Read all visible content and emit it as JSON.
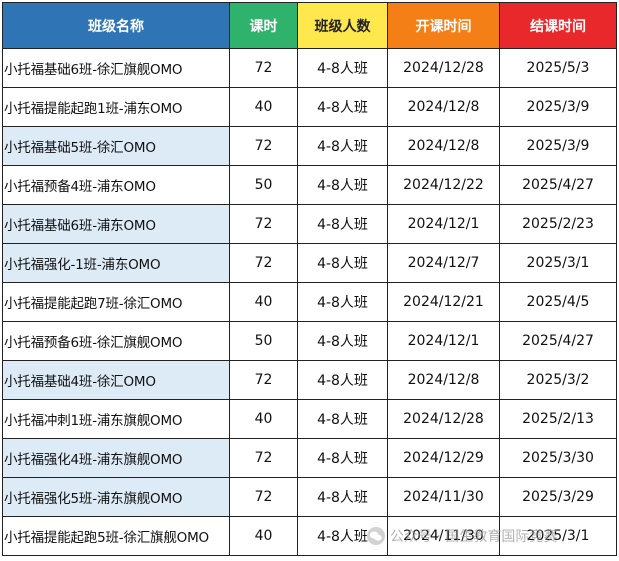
{
  "header": {
    "name": "班级名称",
    "hours": "课时",
    "size": "班级人数",
    "start": "开课时间",
    "end": "结课时间"
  },
  "colors": {
    "header_name_bg": "#2f75b5",
    "header_hours_bg": "#2fb26b",
    "header_size_bg": "#ffe84d",
    "header_start_bg": "#f57f17",
    "header_end_bg": "#e8282b",
    "row_highlight_bg": "#ddebf7"
  },
  "rows": [
    {
      "name": "小托福基础6班-徐汇旗舰OMO",
      "hours": "72",
      "size": "4-8人班",
      "start": "2024/12/28",
      "end": "2025/5/3"
    },
    {
      "name": "小托福提能起跑1班-浦东OMO",
      "hours": "40",
      "size": "4-8人班",
      "start": "2024/12/8",
      "end": "2025/3/9"
    },
    {
      "name": "小托福基础5班-徐汇OMO",
      "hours": "72",
      "size": "4-8人班",
      "start": "2024/12/8",
      "end": "2025/3/9"
    },
    {
      "name": "小托福预备4班-浦东OMO",
      "hours": "50",
      "size": "4-8人班",
      "start": "2024/12/22",
      "end": "2025/4/27"
    },
    {
      "name": "小托福基础6班-浦东OMO",
      "hours": "72",
      "size": "4-8人班",
      "start": "2024/12/1",
      "end": "2025/2/23"
    },
    {
      "name": "小托福强化-1班-浦东OMO",
      "hours": "72",
      "size": "4-8人班",
      "start": "2024/12/7",
      "end": "2025/3/1"
    },
    {
      "name": "小托福提能起跑7班-徐汇OMO",
      "hours": "40",
      "size": "4-8人班",
      "start": "2024/12/21",
      "end": "2025/4/5"
    },
    {
      "name": "小托福预备6班-徐汇旗舰OMO",
      "hours": "50",
      "size": "4-8人班",
      "start": "2024/12/1",
      "end": "2025/4/27"
    },
    {
      "name": "小托福基础4班-徐汇OMO",
      "hours": "72",
      "size": "4-8人班",
      "start": "2024/12/8",
      "end": "2025/3/2"
    },
    {
      "name": "小托福冲刺1班-浦东旗舰OMO",
      "hours": "40",
      "size": "4-8人班",
      "start": "2024/12/28",
      "end": "2025/2/13"
    },
    {
      "name": "小托福强化4班-浦东旗舰OMO",
      "hours": "72",
      "size": "4-8人班",
      "start": "2024/12/29",
      "end": "2025/3/30"
    },
    {
      "name": "小托福强化5班-浦东旗舰OMO",
      "hours": "72",
      "size": "4-8人班",
      "start": "2024/11/30",
      "end": "2025/3/29"
    },
    {
      "name": "小托福提能起跑5班-徐汇旗舰OMO",
      "hours": "40",
      "size": "4-8人班",
      "start": "2024/11/30",
      "end": "2025/3/1"
    }
  ],
  "highlighted_rows": [
    2,
    4,
    5,
    8,
    10,
    11
  ],
  "watermark": {
    "icon": "wechat-icon",
    "text": "公众号 · 国生教育国际竞赛"
  }
}
